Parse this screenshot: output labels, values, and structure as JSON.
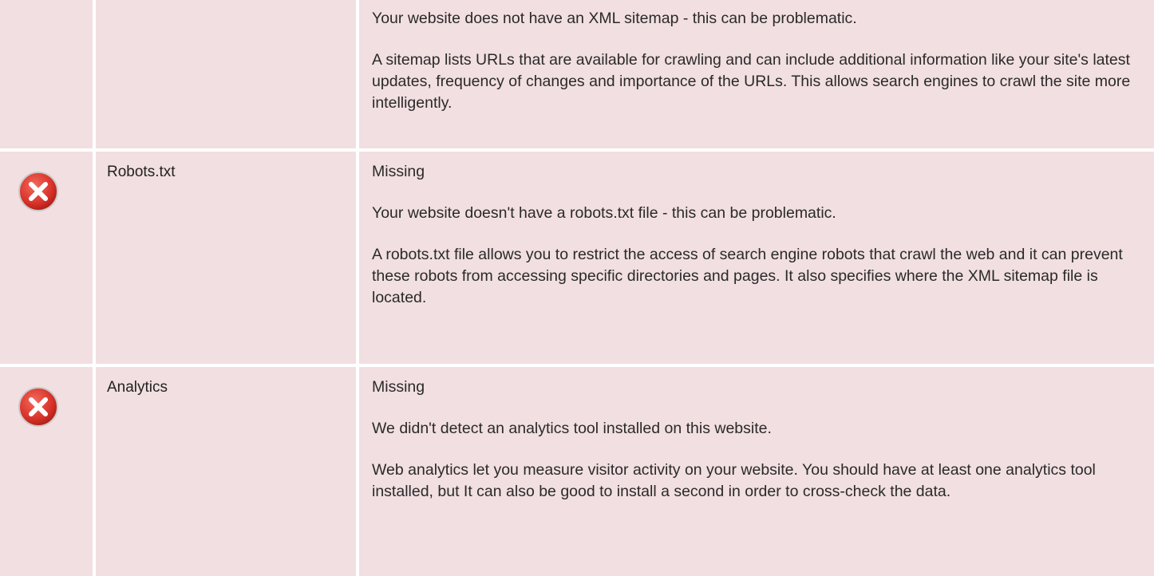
{
  "checks": [
    {
      "name": "",
      "status": "",
      "paragraphs": [
        "Your website does not have an XML sitemap - this can be problematic.",
        "A sitemap lists URLs that are available for crawling and can include additional information like your site's latest updates, frequency of changes and importance of the URLs. This allows search engines to crawl the site more intelligently."
      ]
    },
    {
      "name": "Robots.txt",
      "status": "Missing",
      "paragraphs": [
        "Your website doesn't have a robots.txt file - this can be problematic.",
        "A robots.txt file allows you to restrict the access of search engine robots that crawl the web and it can prevent these robots from accessing specific directories and pages. It also specifies where the XML sitemap file is located."
      ]
    },
    {
      "name": "Analytics",
      "status": "Missing",
      "paragraphs": [
        "We didn't detect an analytics tool installed on this website.",
        "Web analytics let you measure visitor activity on your website. You should have at least one analytics tool installed, but It can also be good to install a second in order to cross-check the data."
      ]
    }
  ],
  "icons": {
    "fail": "error-x-circle-icon"
  },
  "colors": {
    "row_background": "#f2dfe1",
    "fail_icon": "#d9332a"
  }
}
